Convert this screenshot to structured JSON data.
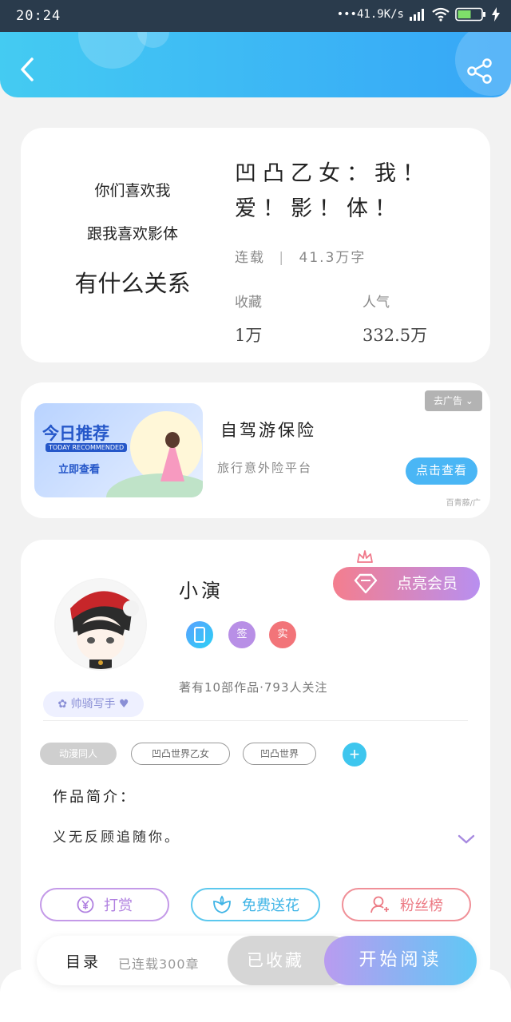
{
  "status_bar": {
    "time": "20:24",
    "network_speed": "41.9K/s",
    "battery_level": 0.5
  },
  "header": {
    "back_icon": "chevron-left-icon",
    "share_icon": "share-icon"
  },
  "book": {
    "cover_lines": [
      "你们喜欢我",
      "跟我喜欢影体",
      "有什么关系"
    ],
    "title_line1": "凹凸乙女：我！",
    "title_line2": "爱！影！体！",
    "status": "连载",
    "word_count": "41.3万字",
    "favorites_label": "收藏",
    "favorites_value": "1万",
    "popularity_label": "人气",
    "popularity_value": "332.5万"
  },
  "ad": {
    "banner_title": "今日推荐",
    "banner_subtitle": "TODAY RECOMMENDED",
    "banner_cta": "立即查看",
    "title": "自驾游保险",
    "description": "旅行意外险平台",
    "button": "点击查看",
    "close_tag": "去广告",
    "source": "百青藤/广"
  },
  "author": {
    "name": "小演",
    "vip_button": "点亮会员",
    "badges": [
      "",
      "签",
      "实"
    ],
    "works_info": "著有10部作品·793人关注",
    "writer_tag": "帅骑写手",
    "tags": [
      "动漫同人",
      "凹凸世界乙女",
      "凹凸世界"
    ],
    "add_tag": "+",
    "intro_label": "作品简介：",
    "intro_text": "义无反顾追随你。",
    "actions": {
      "reward": "打赏",
      "flower": "免费送花",
      "fans": "粉丝榜"
    }
  },
  "bottom_bar": {
    "toc": "目录",
    "toc_status": "已连载300章",
    "collected": "已收藏",
    "start_reading": "开始阅读"
  },
  "colors": {
    "header_start": "#44cbf2",
    "header_end": "#36a6f7",
    "accent_blue": "#4ab6f5",
    "vip_start": "#f47e8e",
    "vip_end": "#b88ff0"
  }
}
